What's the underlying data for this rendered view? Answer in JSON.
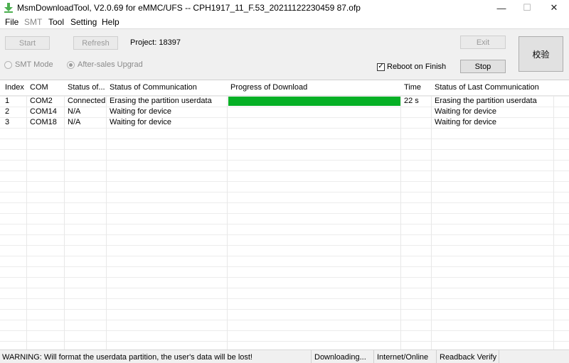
{
  "window": {
    "title": "MsmDownloadTool, V2.0.69 for eMMC/UFS -- CPH1917_11_F.53_20211122230459 87.ofp",
    "minimize_glyph": "—",
    "maximize_glyph": "☐",
    "close_glyph": "✕"
  },
  "menu": {
    "file": "File",
    "smt": "SMT",
    "tool": "Tool",
    "setting": "Setting",
    "help": "Help"
  },
  "toolbar": {
    "start_label": "Start",
    "refresh_label": "Refresh",
    "project_label": "Project: 18397",
    "exit_label": "Exit",
    "stop_label": "Stop",
    "verify_label": "校验",
    "smt_mode_label": "SMT Mode",
    "after_sales_label": "After-sales Upgrad",
    "reboot_label": "Reboot on Finish",
    "reboot_checked": true
  },
  "table": {
    "headers": {
      "index": "Index",
      "com": "COM",
      "status_of": "Status of...",
      "status_comm": "Status of Communication",
      "progress": "Progress of Download",
      "time": "Time",
      "status_last": "Status of Last Communication"
    },
    "rows": [
      {
        "index": "1",
        "com": "COM2",
        "status": "Connected",
        "comm": "Erasing the partition  userdata",
        "progress": 1.0,
        "time": "22 s",
        "last": "Erasing the partition  userdata"
      },
      {
        "index": "2",
        "com": "COM14",
        "status": "N/A",
        "comm": "Waiting for device",
        "progress": 0,
        "time": "",
        "last": "Waiting for device"
      },
      {
        "index": "3",
        "com": "COM18",
        "status": "N/A",
        "comm": "Waiting for device",
        "progress": 0,
        "time": "",
        "last": "Waiting for device"
      }
    ],
    "progress_color": "#06b025"
  },
  "statusbar": {
    "warning": "WARNING: Will format the userdata partition, the user's data will be lost!",
    "downloading": "Downloading...",
    "mode": "Internet/Online",
    "verify": "Readback Verify"
  }
}
